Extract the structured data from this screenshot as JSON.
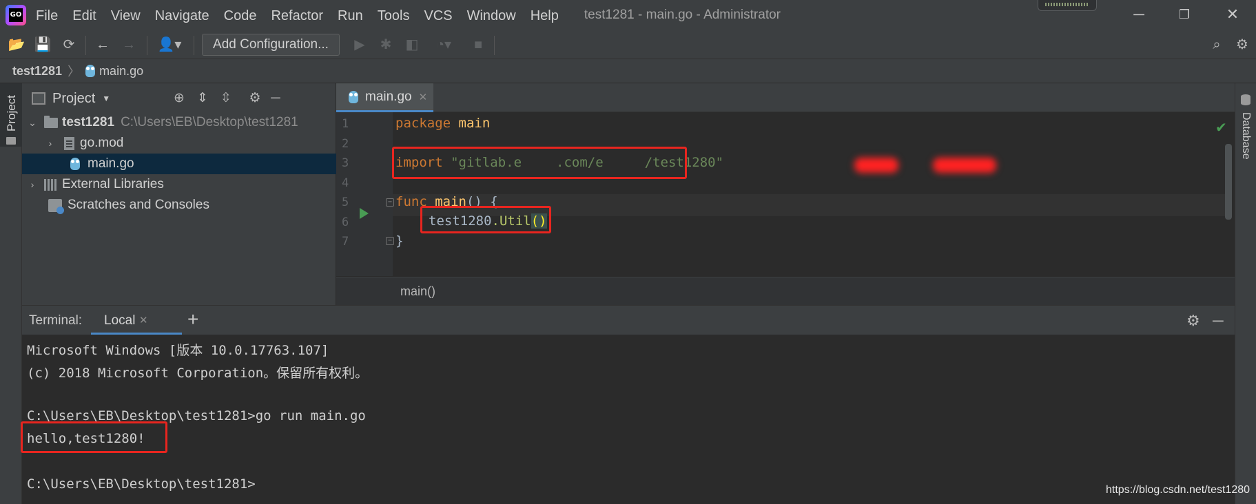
{
  "app": {
    "logo_text": "GO",
    "window_title": "test1281 - main.go - Administrator"
  },
  "menu": [
    "File",
    "Edit",
    "View",
    "Navigate",
    "Code",
    "Refactor",
    "Run",
    "Tools",
    "VCS",
    "Window",
    "Help"
  ],
  "toolbar": {
    "add_configuration_label": "Add Configuration..."
  },
  "breadcrumb": {
    "project": "test1281",
    "file": "main.go"
  },
  "left_strip": {
    "project_tab": "Project"
  },
  "right_strip": {
    "database_tab": "Database"
  },
  "project_panel": {
    "title": "Project",
    "tree": [
      {
        "label": "test1281",
        "path": "C:\\Users\\EB\\Desktop\\test1281"
      },
      {
        "label": "go.mod"
      },
      {
        "label": "main.go"
      },
      {
        "label": "External Libraries"
      },
      {
        "label": "Scratches and Consoles"
      }
    ]
  },
  "editor": {
    "tab_label": "main.go",
    "line_numbers": [
      "1",
      "2",
      "3",
      "4",
      "5",
      "6",
      "7"
    ],
    "code": {
      "l1_kw": "package",
      "l1_rest": " main",
      "l3_kw": "import",
      "l3_str_a": " \"gitlab.e",
      "l3_str_b": ".com/e",
      "l3_str_c": "/test1280\"",
      "l5_kw": "func",
      "l5_fn": " main",
      "l5_rest": "() {",
      "l6_pkg": "test1280",
      "l6_call": ".Util",
      "l6_parens": "()",
      "l7": "}"
    },
    "breadcrumb": "main()"
  },
  "terminal": {
    "label": "Terminal:",
    "tab_label": "Local",
    "add_label": "+",
    "lines": [
      "Microsoft Windows [版本 10.0.17763.107]",
      "(c) 2018 Microsoft Corporation。保留所有权利。",
      "",
      "C:\\Users\\EB\\Desktop\\test1281>go run main.go",
      "hello,test1280!",
      "",
      "C:\\Users\\EB\\Desktop\\test1281>"
    ]
  },
  "watermark": "https://blog.csdn.net/test1280",
  "colors": {
    "background": "#2b2b2b",
    "panel": "#3c3f41",
    "accent": "#4a88c7",
    "annotation_red": "#e8251f"
  }
}
